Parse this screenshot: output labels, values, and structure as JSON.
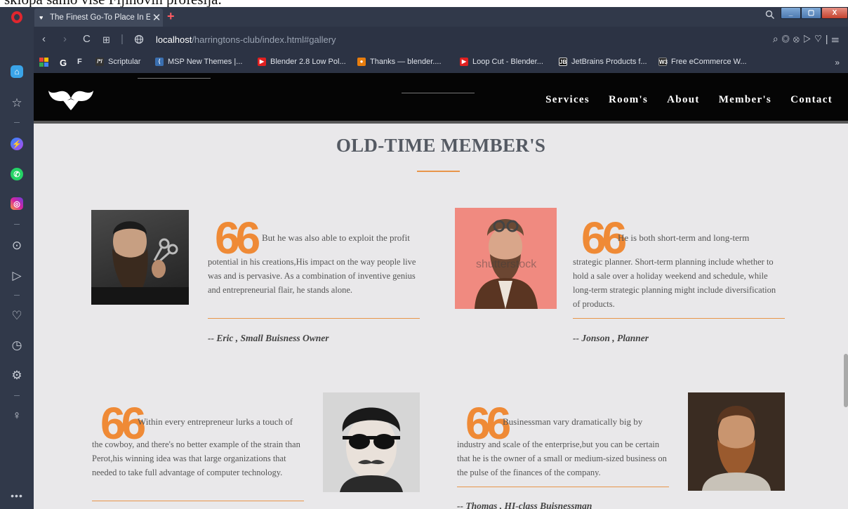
{
  "window": {
    "top_text": "sklopa samo više Fijinovih profesija.",
    "tab_title": "The Finest Go-To Place In E",
    "tab_close": "✕",
    "new_tab": "+",
    "minimize": "_",
    "maximize": "▢",
    "close": "X"
  },
  "nav": {
    "back": "‹",
    "forward": "›",
    "reload": "C",
    "tabs_grid": "⊞",
    "url_host": "localhost",
    "url_path": "/harringtons-club/index.html#gallery"
  },
  "bookmarks": [
    {
      "label": "Scriptular",
      "icon": "scriptular-icon",
      "color": "#333"
    },
    {
      "label": "MSP New Themes |...",
      "icon": "msp-icon",
      "color": "#3a6fb0"
    },
    {
      "label": "Blender 2.8 Low Pol...",
      "icon": "youtube-icon",
      "color": "#e02020"
    },
    {
      "label": "Thanks — blender....",
      "icon": "blender-icon",
      "color": "#e87d0d"
    },
    {
      "label": "Loop Cut - Blender...",
      "icon": "youtube-icon",
      "color": "#e02020"
    },
    {
      "label": "JetBrains Products f...",
      "icon": "jetbrains-icon",
      "color": "#111"
    },
    {
      "label": "Free eCommerce W...",
      "icon": "w3-icon",
      "color": "#222"
    }
  ],
  "bookmarks_more": "»",
  "site": {
    "nav_links": [
      "Services",
      "Room's",
      "About",
      "Member's",
      "Contact"
    ],
    "section_title": "OLD-TIME MEMBER'S",
    "quote_mark": "66",
    "accent": "#ef8a36",
    "cards": [
      {
        "first_line": "But he was also able to exploit the profit",
        "body": "potential in his creations,His impact on the way people live was and is pervasive. As a combination of inventive genius and entrepreneurial flair, he stands alone.",
        "author": "-- Eric , Small Buisness Owner"
      },
      {
        "first_line": "He is both short-term and long-term",
        "body": "strategic planner. Short-term planning include whether to hold a sale over a holiday weekend and schedule, while long-term strategic planning might include diversification of products.",
        "author": "-- Jonson , Planner"
      },
      {
        "first_line": "Within every entrepreneur lurks a touch of",
        "body": "the cowboy, and there's no better example of the strain than Perot,his winning idea was that large organizations that needed to take full advantage of computer technology.",
        "author": ""
      },
      {
        "first_line": "Businessman vary dramatically big by",
        "body": "industry and scale of the enterprise,but you can be certain that he is the owner of a small or medium-sized business on the pulse of the finances of the company.",
        "author": "-- Thomas , HI-class Buisnessman"
      }
    ],
    "watermark": "shutterstock"
  }
}
